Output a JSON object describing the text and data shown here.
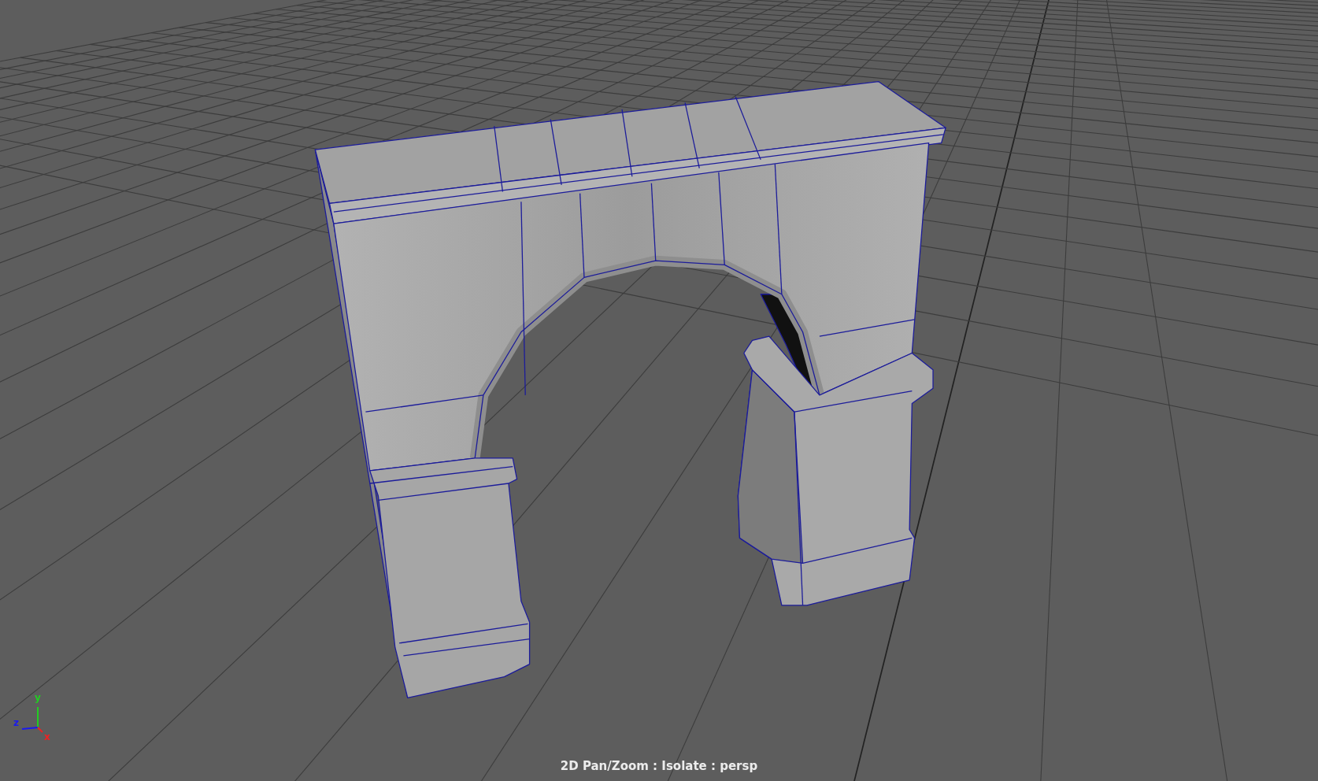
{
  "viewport": {
    "status_text": "2D Pan/Zoom : Isolate : persp",
    "axis_labels": [
      {
        "label": "y",
        "color": "#22cc22"
      },
      {
        "label": "z",
        "color": "#1a1aee"
      },
      {
        "label": "x",
        "color": "#ee2222"
      }
    ]
  }
}
